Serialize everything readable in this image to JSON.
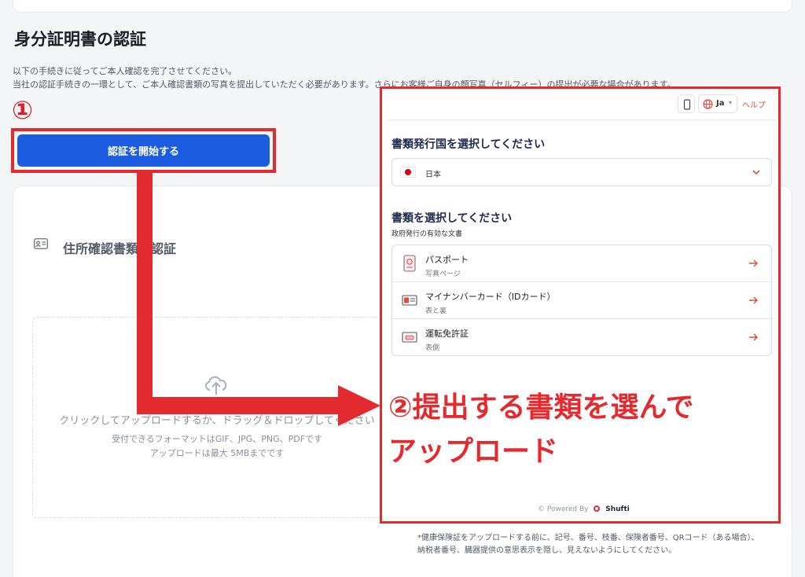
{
  "page": {
    "title": "身分証明書の認証",
    "description_line1": "以下の手続きに従ってご本人確認を完了させてください。",
    "description_line2": "当社の認証手続きの一環として、ご本人確認書類の写真を提出していただく必要があります。さらにお客様ご自身の顔写真（セルフィー）の提出が必要な場合があります。"
  },
  "annotation": {
    "step1": "①",
    "step2_line1": "②提出する書類を選んで",
    "step2_line2": "アップロード",
    "color": "#e32a2f"
  },
  "start_button": {
    "label": "認証を開始する",
    "color": "#1b5ce0"
  },
  "address_section": {
    "title": "住所確認書類の認証",
    "icon": "id-card-icon",
    "dropzone": {
      "text": "クリックしてアップロードするか、ドラッグ＆ドロップしてください",
      "formats": "受付できるフォーマットはGIF、JPG、PNG、PDFです",
      "max_size": "アップロードは最大 5MBまでです"
    },
    "note": "*健康保険証をアップロードする前に、記号、番号、枝番、保険者番号、QRコード（ある場合）、納税者番号、臓器提供の意思表示を隠し、見えないようにしてください。"
  },
  "modal": {
    "lang": "Ja",
    "help": "ヘルプ",
    "country_section_title": "書類発行国を選択してください",
    "country_value": "日本",
    "doc_section_title": "書類を選択してください",
    "doc_section_sub": "政府発行の有効な文書",
    "documents": [
      {
        "name": "パスポート",
        "sub": "写真ページ",
        "icon": "passport-icon"
      },
      {
        "name": "マイナンバーカード（IDカード）",
        "sub": "表と裏",
        "icon": "id-card-icon"
      },
      {
        "name": "運転免許証",
        "sub": "表側",
        "icon": "driving-license-icon"
      }
    ],
    "powered_by": "© Powered By",
    "brand": "Shufti"
  }
}
